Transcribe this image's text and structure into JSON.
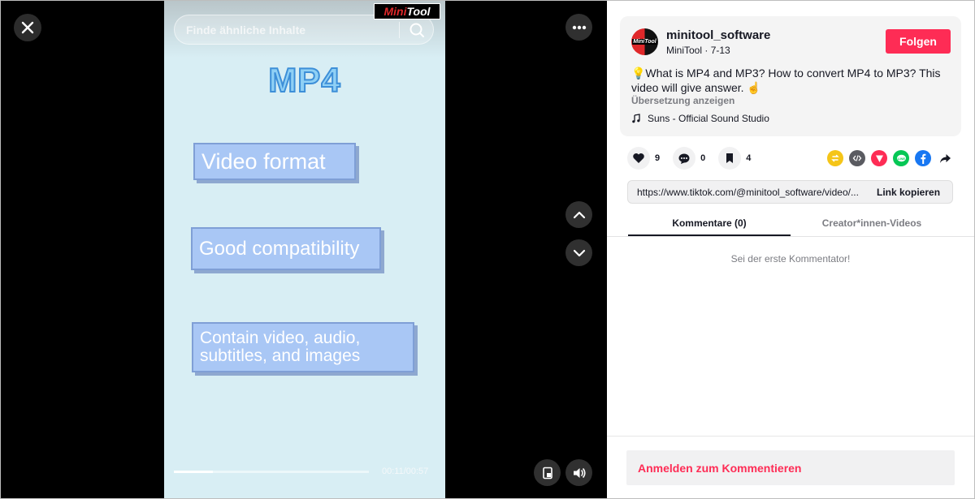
{
  "video": {
    "search_placeholder": "Finde ähnliche Inhalte",
    "watermark": {
      "part1": "Mini",
      "part2": "Tool"
    },
    "headline": "MP4",
    "cards": [
      "Video  format",
      "Good compatibility",
      "Contain video, audio, subtitles, and images"
    ],
    "progress_fraction": 0.2,
    "time_display": "00:11/00:57",
    "buttons": {
      "close": "close-icon",
      "more": "more-icon",
      "prev": "chevron-up-icon",
      "next": "chevron-down-icon",
      "pip": "picture-in-picture-icon",
      "volume": "volume-icon"
    }
  },
  "post": {
    "username": "minitool_software",
    "display_name": "MiniTool",
    "date": "7-13",
    "follow_label": "Folgen",
    "description": "💡What is MP4 and MP3? How to convert MP4 to MP3? This video will give answer. ☝️",
    "translate_label": "Übersetzung anzeigen",
    "music": "Suns - Official Sound Studio"
  },
  "stats": {
    "likes": "9",
    "comments": "0",
    "saves": "4"
  },
  "share_icons": [
    "repost-icon",
    "embed-icon",
    "send-icon",
    "line-icon",
    "facebook-icon",
    "share-arrow-icon"
  ],
  "link": {
    "url": "https://www.tiktok.com/@minitool_software/video/...",
    "copy_label": "Link kopieren"
  },
  "tabs": {
    "comments": "Kommentare (0)",
    "creator_videos": "Creator*innen-Videos"
  },
  "comments": {
    "empty_text": "Sei der erste Kommentator!",
    "login_label": "Anmelden zum Kommentieren"
  },
  "colors": {
    "accent": "#fe2c55",
    "video_bg": "#d8eef4",
    "card": "#a9c7f5"
  }
}
